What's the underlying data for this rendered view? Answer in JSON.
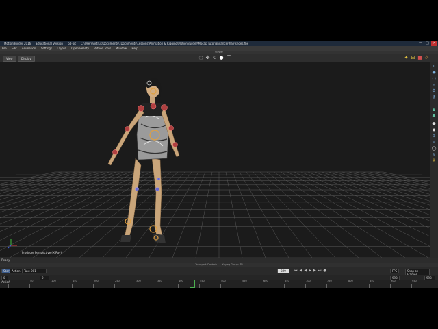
{
  "window": {
    "title": "MotionBuilder 2016",
    "edition": "Educational Version",
    "bits": "64-bit",
    "path": "C:\\Users\\gstruk\\Documents\\_Documents\\Lessons\\Animation & Rigging\\MotionBuilder\\Mocap Tutorial\\dancer-hair-shoes.fbx",
    "min": "—",
    "max": "□",
    "close": "✕"
  },
  "menu": [
    "File",
    "Edit",
    "Animation",
    "Settings",
    "Layout",
    "Open Reality",
    "Python Tools",
    "Window",
    "Help"
  ],
  "toolbar": {
    "section_label": "Viewer",
    "view_btn": "View",
    "display_btn": "Display"
  },
  "viewport": {
    "camera_label": "Producer Perspective (X-Ray)",
    "axis": {
      "x": "X",
      "y": "Y",
      "z": "Z"
    }
  },
  "status": {
    "text": "Ready"
  },
  "transport": {
    "title": "Transport Controls",
    "keying_group": "Keying Group: TR",
    "story": "Story",
    "action": "Action",
    "take": "Take 001",
    "current_frame": "399",
    "fps": "FPS",
    "snap": "Snap on Frames",
    "start": "0",
    "end": "998",
    "range_start": "0",
    "range_end": "998"
  },
  "timeline": {
    "ticks": [
      "0",
      "50",
      "100",
      "150",
      "200",
      "250",
      "300",
      "350",
      "400",
      "450",
      "500",
      "550",
      "600",
      "650",
      "700",
      "750",
      "800",
      "850",
      "900",
      "950"
    ],
    "track_label": "Action"
  },
  "colors": {
    "viewport_bg": "#1b1b1b",
    "grid": "#5a5a5a",
    "accent": "#7fb3e0",
    "ik_effector": "#e0a040",
    "fk_joint": "#c03030"
  }
}
